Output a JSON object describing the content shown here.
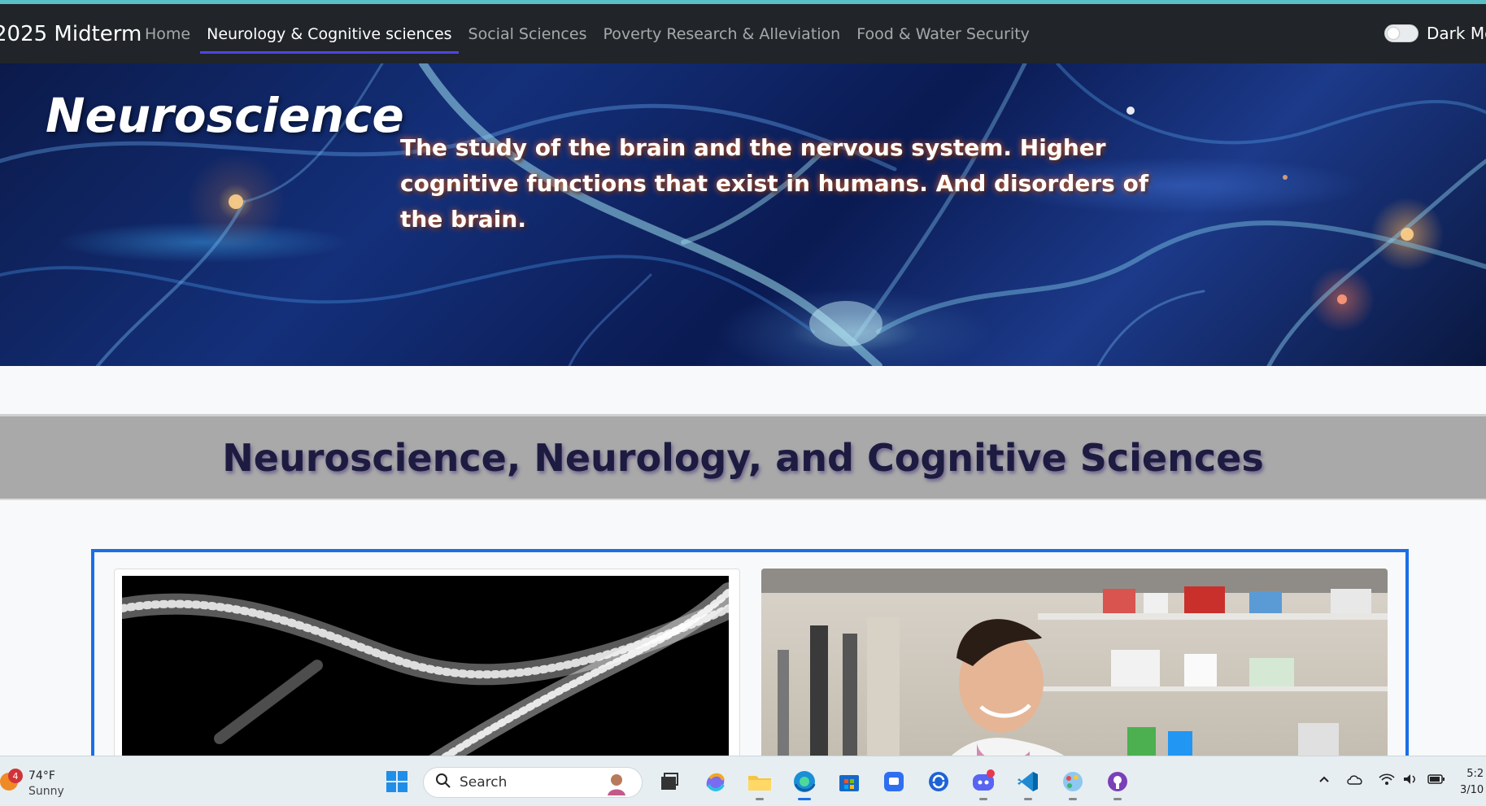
{
  "navbar": {
    "brand": "2025 Midterm",
    "links": [
      {
        "label": "Home",
        "active": false
      },
      {
        "label": "Neurology & Cognitive sciences",
        "active": true
      },
      {
        "label": "Social Sciences",
        "active": false
      },
      {
        "label": "Poverty Research & Alleviation",
        "active": false
      },
      {
        "label": "Food & Water Security",
        "active": false
      }
    ],
    "dark_mode_label": "Dark Mo"
  },
  "hero": {
    "title": "Neuroscience",
    "description": "The study of the brain and the nervous system. Higher cognitive functions that exist in humans. And disorders of the brain."
  },
  "section": {
    "title": "Neuroscience, Neurology, and Cognitive Sciences"
  },
  "taskbar": {
    "weather": {
      "badge": "4",
      "temp": "74°F",
      "condition": "Sunny"
    },
    "search_placeholder": "Search",
    "clock": {
      "time": "5:2",
      "date": "3/10"
    }
  },
  "colors": {
    "navbar_bg": "#212529",
    "accent_line": "#5bc0c6",
    "active_underline": "#4f46e5",
    "card_frame": "#1a6fe8",
    "section_band": "#a9a9a9"
  }
}
